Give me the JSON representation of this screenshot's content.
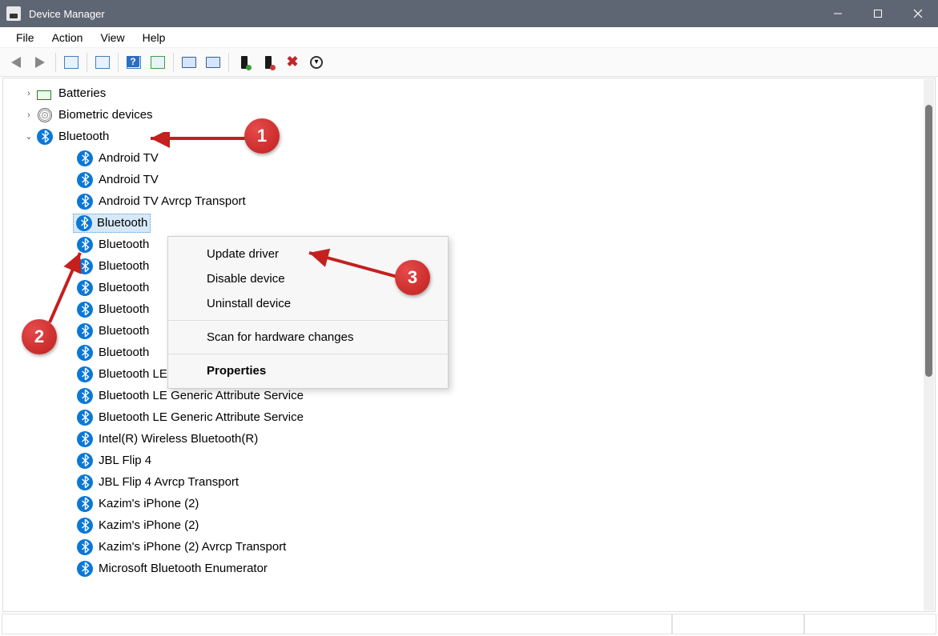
{
  "window": {
    "title": "Device Manager"
  },
  "menubar": {
    "items": [
      "File",
      "Action",
      "View",
      "Help"
    ]
  },
  "tree": {
    "categories": [
      {
        "label": "Batteries",
        "expanded": false,
        "icon": "battery"
      },
      {
        "label": "Biometric devices",
        "expanded": false,
        "icon": "biometric"
      },
      {
        "label": "Bluetooth",
        "expanded": true,
        "icon": "bluetooth"
      }
    ],
    "bluetooth_devices": [
      "Android TV",
      "Android TV",
      "Android TV Avrcp Transport",
      "Bluetooth",
      "Bluetooth",
      "Bluetooth",
      "Bluetooth",
      "Bluetooth",
      "Bluetooth",
      "Bluetooth",
      "Bluetooth LE Generic Attribute Service",
      "Bluetooth LE Generic Attribute Service",
      "Bluetooth LE Generic Attribute Service",
      "Intel(R) Wireless Bluetooth(R)",
      "JBL Flip 4",
      "JBL Flip 4 Avrcp Transport",
      "Kazim's iPhone (2)",
      "Kazim's iPhone (2)",
      "Kazim's iPhone (2) Avrcp Transport",
      "Microsoft Bluetooth Enumerator"
    ],
    "selected_index": 3
  },
  "context_menu": {
    "items": [
      {
        "label": "Update driver",
        "bold": false
      },
      {
        "label": "Disable device",
        "bold": false
      },
      {
        "label": "Uninstall device",
        "bold": false
      },
      {
        "sep": true
      },
      {
        "label": "Scan for hardware changes",
        "bold": false
      },
      {
        "sep": true
      },
      {
        "label": "Properties",
        "bold": true
      }
    ]
  },
  "annotations": {
    "c1": "1",
    "c2": "2",
    "c3": "3"
  }
}
